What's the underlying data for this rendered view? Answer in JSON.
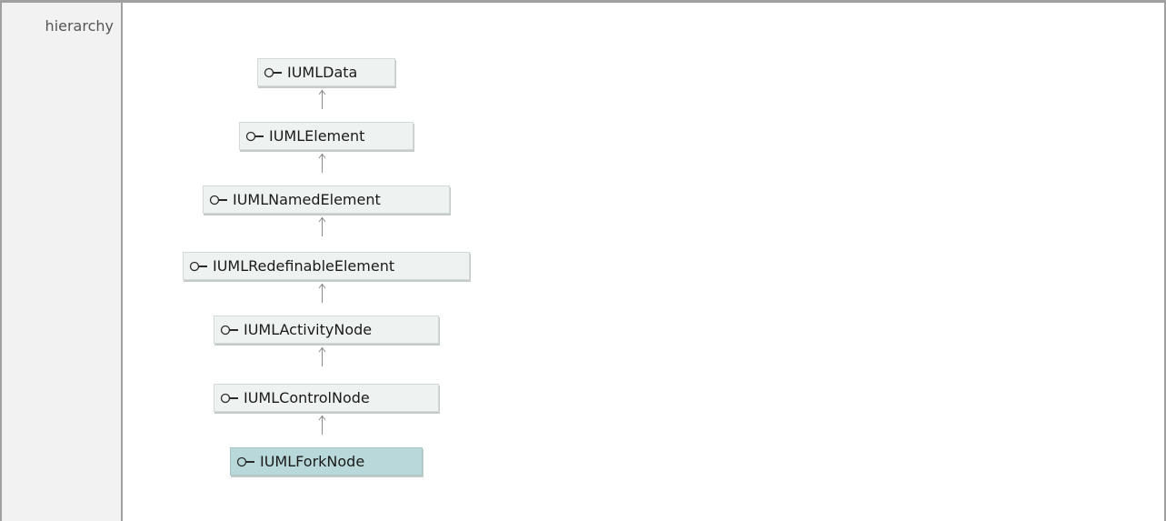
{
  "section_label": "hierarchy",
  "hierarchy": {
    "nodes": [
      {
        "name": "IUMLData",
        "icon": "interface-lollipop-icon",
        "current": false
      },
      {
        "name": "IUMLElement",
        "icon": "interface-lollipop-icon",
        "current": false
      },
      {
        "name": "IUMLNamedElement",
        "icon": "interface-lollipop-icon",
        "current": false
      },
      {
        "name": "IUMLRedefinableElement",
        "icon": "interface-lollipop-icon",
        "current": false
      },
      {
        "name": "IUMLActivityNode",
        "icon": "interface-lollipop-icon",
        "current": false
      },
      {
        "name": "IUMLControlNode",
        "icon": "interface-lollipop-icon",
        "current": false
      },
      {
        "name": "IUMLForkNode",
        "icon": "interface-lollipop-icon",
        "current": true
      }
    ],
    "edges": [
      {
        "from": "IUMLElement",
        "to": "IUMLData"
      },
      {
        "from": "IUMLNamedElement",
        "to": "IUMLElement"
      },
      {
        "from": "IUMLRedefinableElement",
        "to": "IUMLNamedElement"
      },
      {
        "from": "IUMLActivityNode",
        "to": "IUMLRedefinableElement"
      },
      {
        "from": "IUMLControlNode",
        "to": "IUMLActivityNode"
      },
      {
        "from": "IUMLForkNode",
        "to": "IUMLControlNode"
      }
    ]
  },
  "colors": {
    "node_fill": "#eef2f0",
    "current_node_fill": "#b9d8d9",
    "border": "#a0a0a0",
    "label_column_fill": "#f2f2f2"
  }
}
